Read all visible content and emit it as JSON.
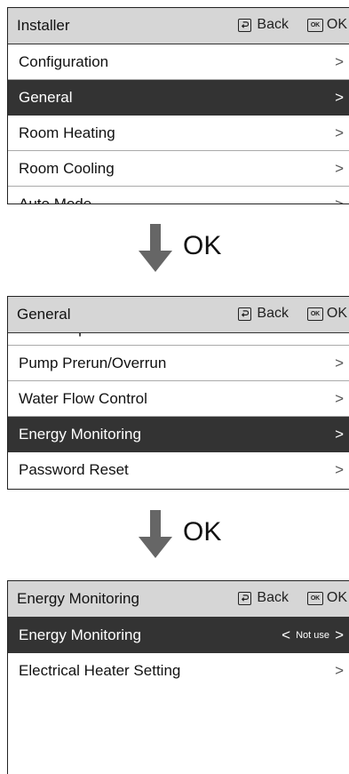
{
  "screens": [
    {
      "title": "Installer",
      "back_label": "Back",
      "ok_icon_text": "OK",
      "ok_label": "OK",
      "items": [
        {
          "label": "Configuration"
        },
        {
          "label": "General"
        },
        {
          "label": "Room Heating"
        },
        {
          "label": "Room Cooling"
        },
        {
          "label": "Auto Mode"
        }
      ],
      "selected_index": 1
    },
    {
      "title": "General",
      "back_label": "Back",
      "ok_icon_text": "OK",
      "ok_label": "OK",
      "items": [
        {
          "label": "Forced operation"
        },
        {
          "label": "Pump Prerun/Overrun"
        },
        {
          "label": "Water Flow Control"
        },
        {
          "label": "Energy Monitoring"
        },
        {
          "label": "Password Reset"
        }
      ],
      "selected_index": 3
    },
    {
      "title": "Energy Monitoring",
      "back_label": "Back",
      "ok_icon_text": "OK",
      "ok_label": "OK",
      "items": [
        {
          "label": "Energy Monitoring",
          "value": "Not use"
        },
        {
          "label": "Electrical Heater Setting"
        }
      ],
      "selected_index": 0
    }
  ],
  "transitions": [
    {
      "label": "OK"
    },
    {
      "label": "OK"
    }
  ],
  "icons": {
    "chevron": "chevron-right-icon",
    "back": "back-icon",
    "ok": "ok-key-icon",
    "arrow": "arrow-down-icon"
  },
  "colors": {
    "header_bg": "#d6d6d6",
    "selected_bg": "#333333",
    "arrow": "#666666"
  }
}
